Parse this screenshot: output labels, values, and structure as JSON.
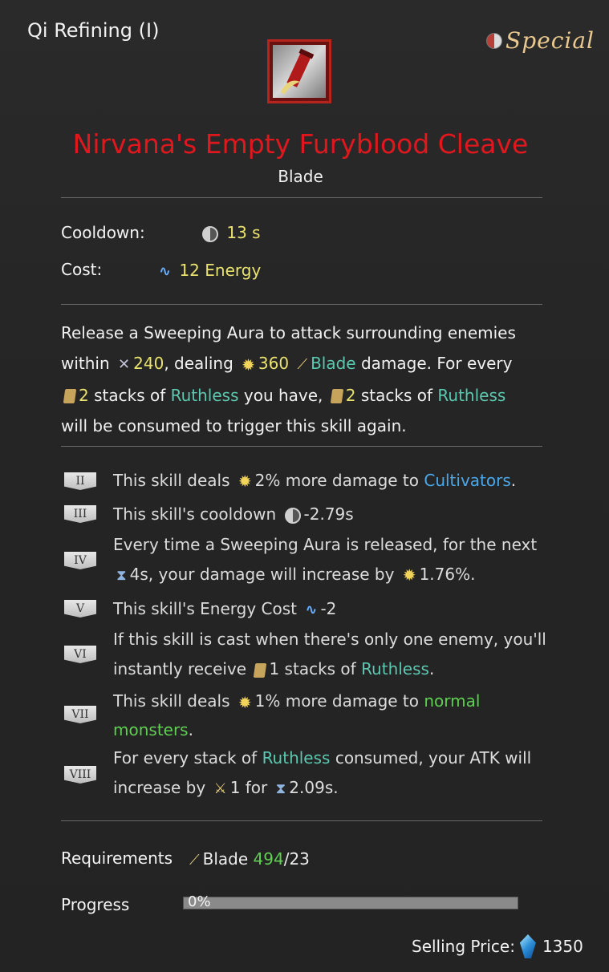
{
  "header": {
    "title": "Qi Refining (I)",
    "badge": "Special"
  },
  "item": {
    "name": "Nirvana's Empty Furyblood Cleave",
    "type": "Blade",
    "icon": "scroll-blade-icon"
  },
  "stats": {
    "cooldown_label": "Cooldown:",
    "cooldown_value": "13 s",
    "cost_label": "Cost:",
    "cost_value": "12 Energy"
  },
  "description": {
    "p1": "Release a Sweeping Aura to attack surrounding enemies",
    "p2a": "within",
    "range": "240",
    "p2b": ", dealing",
    "damage": "360",
    "element": "Blade",
    "p2c": "damage. For every",
    "stacks1": "2",
    "p3a": "stacks of",
    "ruthless": "Ruthless",
    "p3b": "you have,",
    "stacks2": "2",
    "p3c": "stacks of",
    "p4": "will be consumed to trigger this skill again."
  },
  "tiers": [
    {
      "tag": "II",
      "t1": "This skill deals",
      "v": "2% more damage to",
      "target": "Cultivators",
      "end": "."
    },
    {
      "tag": "III",
      "t1": "This skill's cooldown",
      "v": "-2.79s"
    },
    {
      "tag": "IV",
      "l1": "Every time a Sweeping Aura is released, for the next",
      "dur": "4s, your damage will increase by",
      "pct": "1.76%."
    },
    {
      "tag": "V",
      "t1": "This skill's Energy Cost",
      "v": "-2"
    },
    {
      "tag": "VI",
      "l1": "If this skill is cast when there's only one enemy, you'll",
      "l2a": "instantly receive",
      "n": "1 stacks of",
      "kw": "Ruthless",
      "end": "."
    },
    {
      "tag": "VII",
      "t1": "This skill deals",
      "v": "1% more damage to",
      "target": "normal",
      "l2": "monsters",
      "end": "."
    },
    {
      "tag": "VIII",
      "l1a": "For every stack of",
      "kw": "Ruthless",
      "l1b": "consumed, your ATK will",
      "l2a": "increase by",
      "n": "1 for",
      "dur": "2.09s."
    }
  ],
  "requirements": {
    "label": "Requirements",
    "skill": "Blade",
    "current": "494",
    "required": "/23"
  },
  "progress": {
    "label": "Progress",
    "value": "0%",
    "fraction": 0
  },
  "price": {
    "label": "Selling Price:",
    "value": "1350",
    "icon": "spirit-stone-icon"
  }
}
